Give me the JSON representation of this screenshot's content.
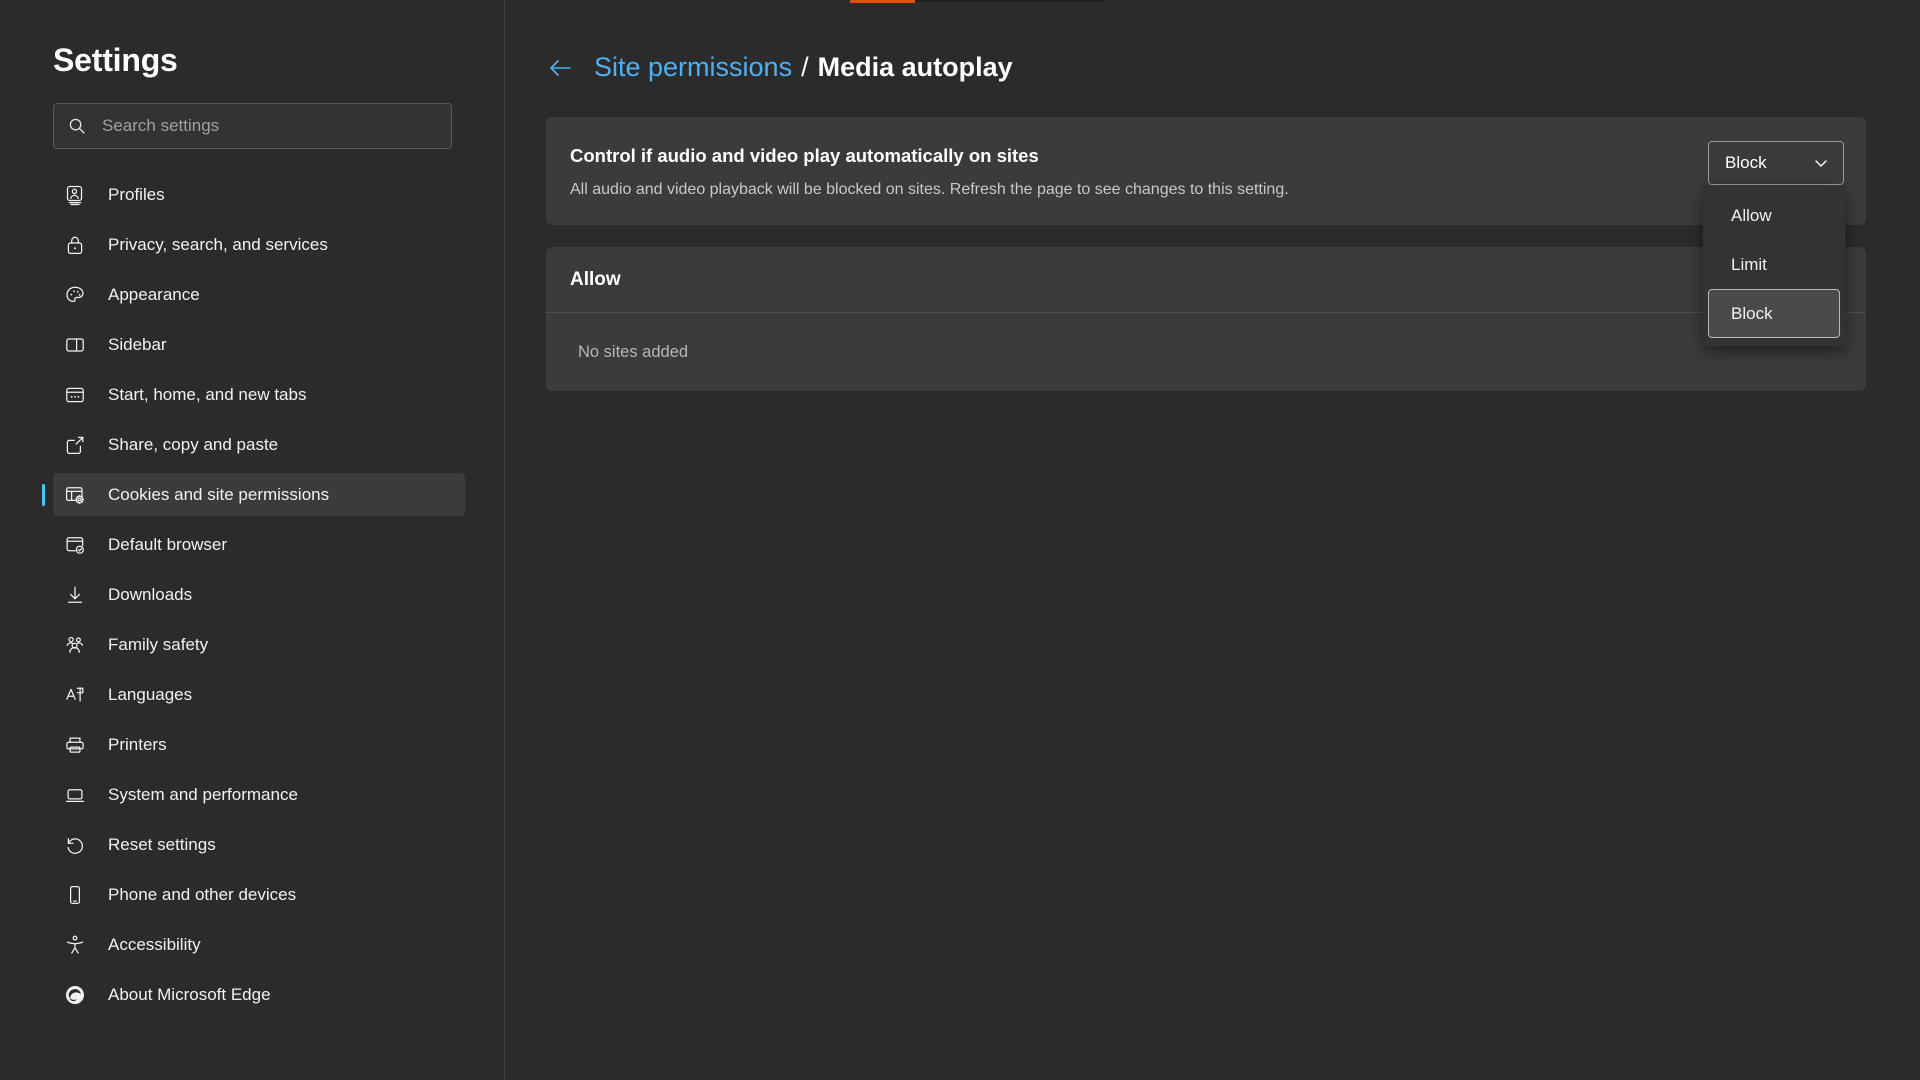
{
  "window": {
    "background_color": "#2b2b2b",
    "accent_color": "#4cc2ff",
    "link_color": "#4cb0f5",
    "progress_color": "#e8500e"
  },
  "sidebar": {
    "title": "Settings",
    "search": {
      "placeholder": "Search settings",
      "value": "",
      "icon": "search-icon"
    },
    "items": [
      {
        "label": "Profiles",
        "icon": "profiles-icon",
        "selected": false
      },
      {
        "label": "Privacy, search, and services",
        "icon": "lock-icon",
        "selected": false
      },
      {
        "label": "Appearance",
        "icon": "palette-icon",
        "selected": false
      },
      {
        "label": "Sidebar",
        "icon": "sidebar-panel-icon",
        "selected": false
      },
      {
        "label": "Start, home, and new tabs",
        "icon": "window-dots-icon",
        "selected": false
      },
      {
        "label": "Share, copy and paste",
        "icon": "share-icon",
        "selected": false
      },
      {
        "label": "Cookies and site permissions",
        "icon": "cookies-permissions-icon",
        "selected": true
      },
      {
        "label": "Default browser",
        "icon": "default-browser-check-icon",
        "selected": false
      },
      {
        "label": "Downloads",
        "icon": "download-arrow-icon",
        "selected": false
      },
      {
        "label": "Family safety",
        "icon": "family-people-icon",
        "selected": false
      },
      {
        "label": "Languages",
        "icon": "languages-icon",
        "selected": false
      },
      {
        "label": "Printers",
        "icon": "printer-icon",
        "selected": false
      },
      {
        "label": "System and performance",
        "icon": "laptop-icon",
        "selected": false
      },
      {
        "label": "Reset settings",
        "icon": "reset-arrow-icon",
        "selected": false
      },
      {
        "label": "Phone and other devices",
        "icon": "phone-icon",
        "selected": false
      },
      {
        "label": "Accessibility",
        "icon": "accessibility-person-icon",
        "selected": false
      },
      {
        "label": "About Microsoft Edge",
        "icon": "edge-logo-icon",
        "selected": false
      }
    ]
  },
  "main": {
    "breadcrumb": {
      "back_icon": "back-arrow-icon",
      "parent": "Site permissions",
      "separator": "/",
      "current": "Media autoplay"
    },
    "autoplay_card": {
      "title": "Control if audio and video play automatically on sites",
      "description": "All audio and video playback will be blocked on sites. Refresh the page to see changes to this setting.",
      "control": {
        "selected_value": "Block",
        "chevron_icon": "chevron-down-icon",
        "expanded": true,
        "options": [
          {
            "label": "Allow",
            "active": false
          },
          {
            "label": "Limit",
            "active": false
          },
          {
            "label": "Block",
            "active": true
          }
        ]
      }
    },
    "allow_card": {
      "title": "Allow",
      "empty_text": "No sites added"
    }
  }
}
